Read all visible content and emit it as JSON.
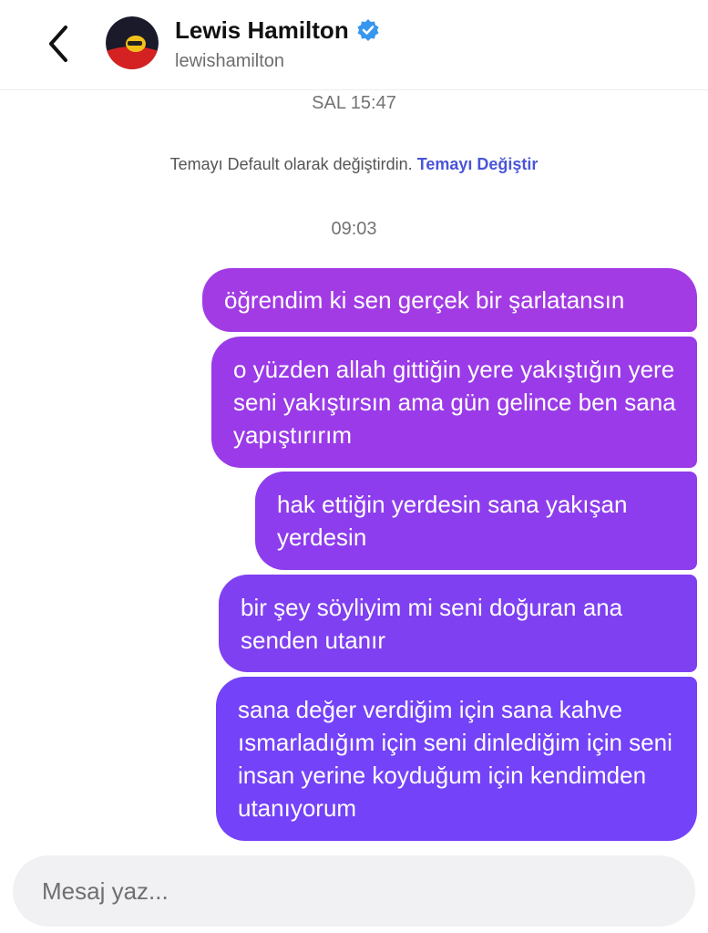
{
  "header": {
    "name": "Lewis Hamilton",
    "handle": "lewishamilton"
  },
  "timestamps": {
    "first": "SAL 15:47",
    "second": "09:03"
  },
  "theme_notice": {
    "text": "Temayı Default olarak değiştirdin.",
    "link": "Temayı Değiştir"
  },
  "messages": [
    {
      "text": "öğrendim ki sen gerçek bir şarlatansın"
    },
    {
      "text": "o yüzden allah gittiğin yere yakıştığın yere seni yakıştırsın ama gün gelince ben sana yapıştırırım"
    },
    {
      "text": "hak ettiğin yerdesin sana yakışan yerdesin"
    },
    {
      "text": "bir şey söyliyim mi seni doğuran ana senden utanır"
    },
    {
      "text": "sana değer verdiğim için sana kahve ısmarladığım için seni dinlediğim için seni insan yerine koyduğum için kendimden utanıyorum"
    }
  ],
  "composer": {
    "placeholder": "Mesaj yaz..."
  },
  "colors": {
    "link": "#4a55d8",
    "verified": "#3797f0",
    "bubble_top": "#a23be4",
    "bubble_bottom": "#7442f8"
  },
  "icons": [
    "back-chevron-icon",
    "verified-badge-icon"
  ]
}
